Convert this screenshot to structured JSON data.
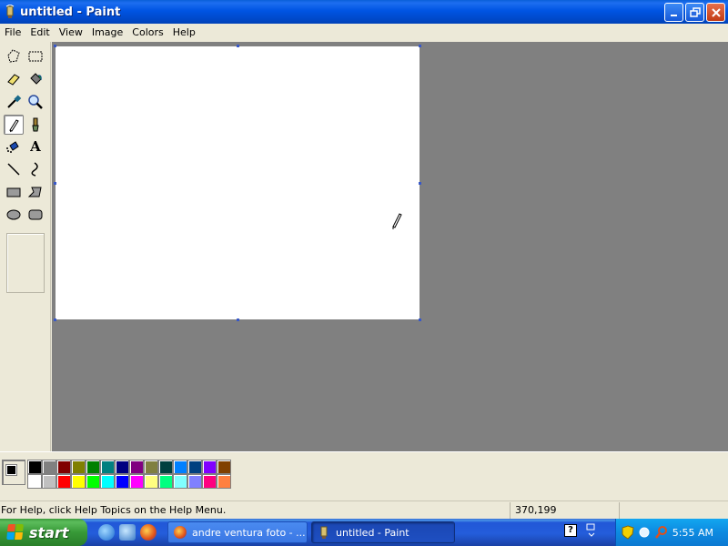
{
  "window": {
    "title": "untitled - Paint"
  },
  "menu": {
    "items": [
      "File",
      "Edit",
      "View",
      "Image",
      "Colors",
      "Help"
    ]
  },
  "toolbox": {
    "tools": [
      {
        "name": "free-form-select-icon"
      },
      {
        "name": "select-icon"
      },
      {
        "name": "eraser-icon"
      },
      {
        "name": "fill-bucket-icon"
      },
      {
        "name": "pick-color-icon"
      },
      {
        "name": "magnifier-icon"
      },
      {
        "name": "pencil-icon",
        "selected": true
      },
      {
        "name": "brush-icon"
      },
      {
        "name": "airbrush-icon"
      },
      {
        "name": "text-icon",
        "glyph": "A"
      },
      {
        "name": "line-icon"
      },
      {
        "name": "curve-icon"
      },
      {
        "name": "rectangle-icon"
      },
      {
        "name": "polygon-icon"
      },
      {
        "name": "ellipse-icon"
      },
      {
        "name": "rounded-rectangle-icon"
      }
    ]
  },
  "palette": {
    "foreground": "#000000",
    "background": "#ffffff",
    "colors_row1": [
      "#000000",
      "#808080",
      "#800000",
      "#808000",
      "#008000",
      "#008080",
      "#000080",
      "#800080",
      "#808040",
      "#004040",
      "#0080ff",
      "#004080",
      "#8000ff",
      "#804000"
    ],
    "colors_row2": [
      "#ffffff",
      "#c0c0c0",
      "#ff0000",
      "#ffff00",
      "#00ff00",
      "#00ffff",
      "#0000ff",
      "#ff00ff",
      "#ffff80",
      "#00ff80",
      "#80ffff",
      "#8080ff",
      "#ff0080",
      "#ff8040"
    ]
  },
  "statusbar": {
    "help_text": "For Help, click Help Topics on the Help Menu.",
    "coords": "370,199"
  },
  "taskbar": {
    "start_label": "start",
    "tasks": [
      {
        "label": "andre ventura foto - ...",
        "icon": "firefox-icon",
        "active": false
      },
      {
        "label": "untitled - Paint",
        "icon": "paint-icon",
        "active": true
      }
    ],
    "clock": "5:55 AM"
  },
  "colors": {
    "titlebar_blue": "#0054e3",
    "workspace_gray": "#808080",
    "chrome_beige": "#ece9d8"
  }
}
